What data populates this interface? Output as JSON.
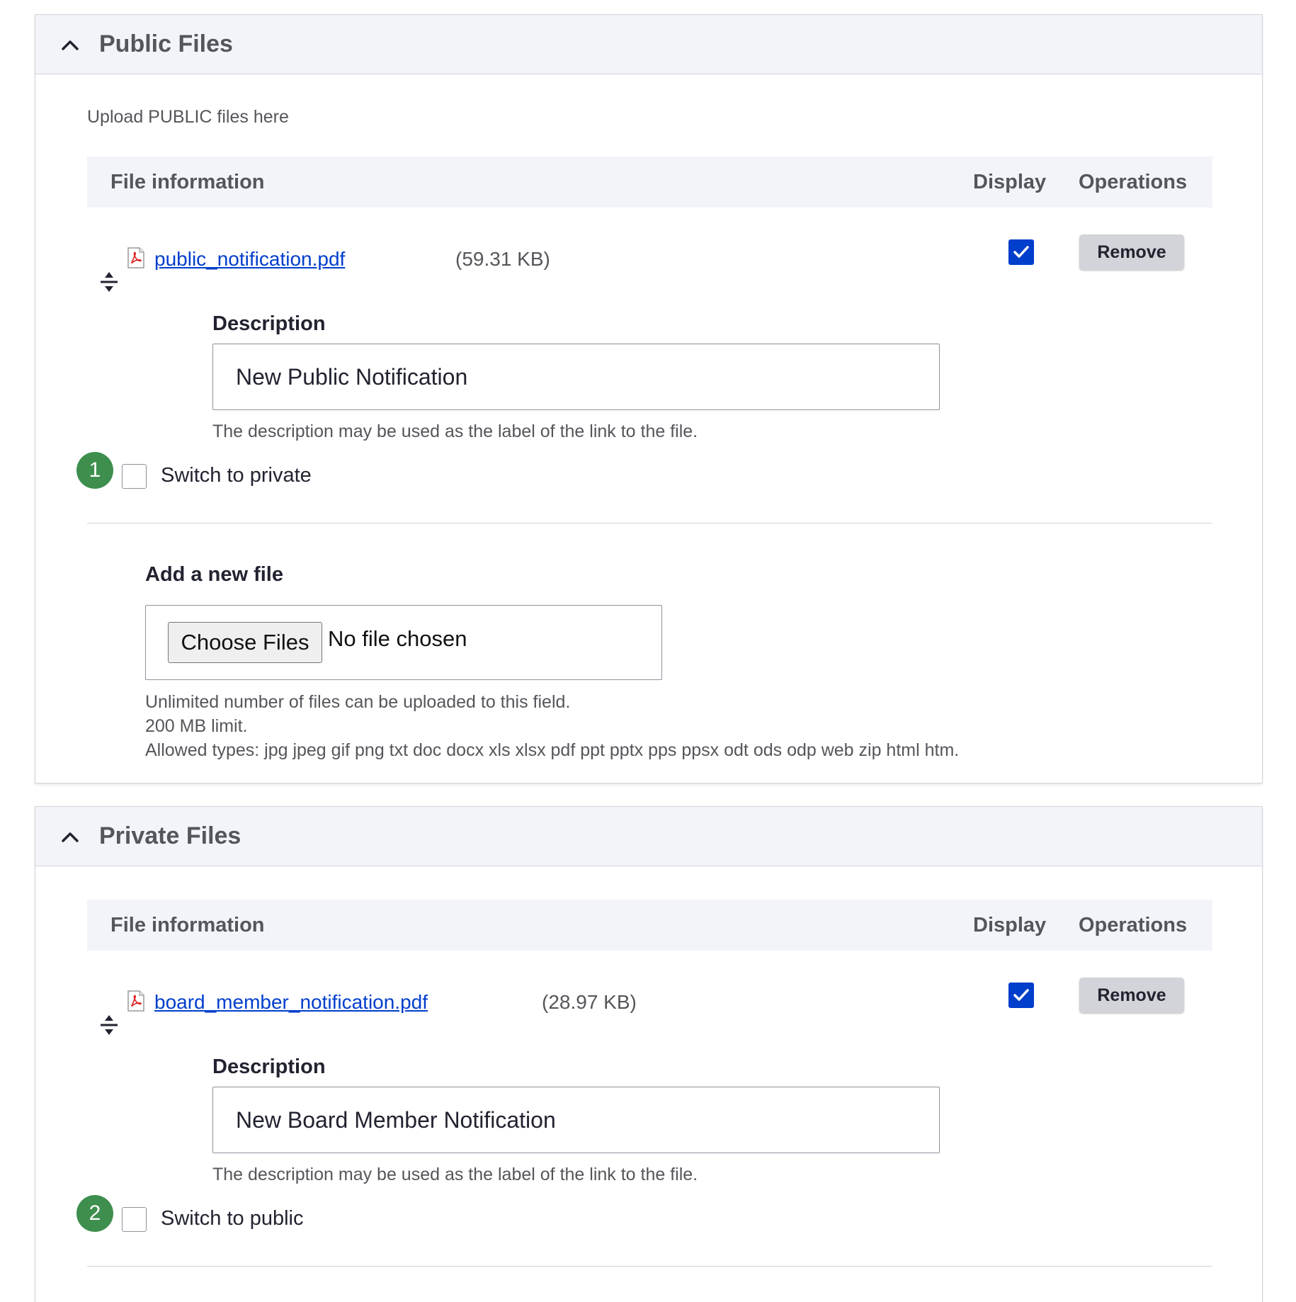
{
  "public_panel": {
    "title": "Public Files",
    "helper": "Upload PUBLIC files here",
    "table": {
      "col_info": "File information",
      "col_display": "Display",
      "col_operations": "Operations"
    },
    "file": {
      "name": "public_notification.pdf",
      "size": "(59.31 KB)",
      "display_checked": true,
      "remove_label": "Remove",
      "description_label": "Description",
      "description_value": "New Public Notification",
      "description_help": "The description may be used as the label of the link to the file."
    },
    "step_badge": "1",
    "switch_label": "Switch to private",
    "add_file": {
      "label": "Add a new file",
      "choose_label": "Choose Files",
      "no_file_text": "No file chosen",
      "help_line1": "Unlimited number of files can be uploaded to this field.",
      "help_line2": "200 MB limit.",
      "help_line3": "Allowed types: jpg jpeg gif png txt doc docx xls xlsx pdf ppt pptx pps ppsx odt ods odp web zip html htm."
    }
  },
  "private_panel": {
    "title": "Private Files",
    "table": {
      "col_info": "File information",
      "col_display": "Display",
      "col_operations": "Operations"
    },
    "file": {
      "name": "board_member_notification.pdf",
      "size": "(28.97 KB)",
      "display_checked": true,
      "remove_label": "Remove",
      "description_label": "Description",
      "description_value": "New Board Member Notification",
      "description_help": "The description may be used as the label of the link to the file."
    },
    "step_badge": "2",
    "switch_label": "Switch to public"
  },
  "colors": {
    "link": "#003ecc",
    "checkbox_checked": "#003ecc",
    "step_badge": "#3e8e4e",
    "header_bg": "#f3f4f9",
    "button_bg": "#d3d4d9"
  },
  "icons": [
    "chevron-up-icon",
    "drag-handle-icon",
    "pdf-file-icon",
    "checkmark-icon"
  ]
}
